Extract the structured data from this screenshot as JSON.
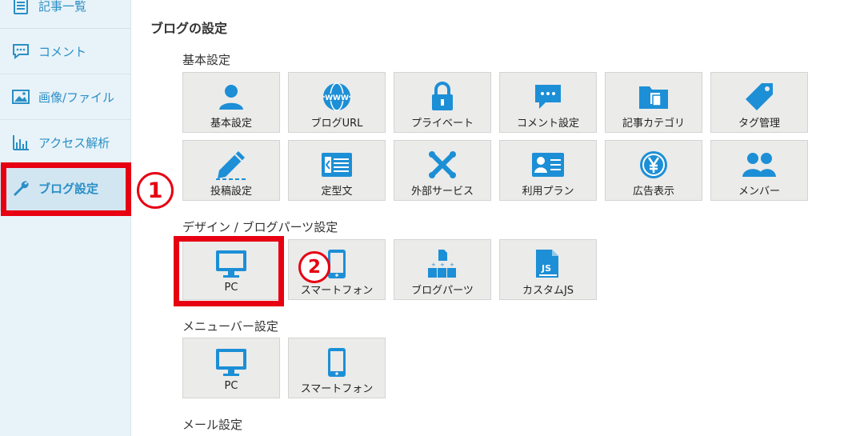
{
  "sidebar": {
    "items": [
      {
        "label": "記事一覧",
        "icon": "document-list-icon",
        "active": false
      },
      {
        "label": "コメント",
        "icon": "comment-icon",
        "active": false
      },
      {
        "label": "画像/ファイル",
        "icon": "image-icon",
        "active": false
      },
      {
        "label": "アクセス解析",
        "icon": "bar-chart-icon",
        "active": false
      },
      {
        "label": "ブログ設定",
        "icon": "wrench-icon",
        "active": true
      }
    ]
  },
  "main": {
    "title": "ブログの設定",
    "sections": [
      {
        "title": "基本設定",
        "tiles": [
          {
            "label": "基本設定",
            "icon": "user-icon"
          },
          {
            "label": "ブログURL",
            "icon": "www-globe-icon"
          },
          {
            "label": "プライベート",
            "icon": "lock-icon"
          },
          {
            "label": "コメント設定",
            "icon": "speech-bubble-icon"
          },
          {
            "label": "記事カテゴリ",
            "icon": "folder-icon"
          },
          {
            "label": "タグ管理",
            "icon": "tag-icon"
          },
          {
            "label": "投稿設定",
            "icon": "pencil-icon"
          },
          {
            "label": "定型文",
            "icon": "template-icon"
          },
          {
            "label": "外部サービス",
            "icon": "external-service-icon"
          },
          {
            "label": "利用プラン",
            "icon": "id-card-icon"
          },
          {
            "label": "広告表示",
            "icon": "yen-coin-icon"
          },
          {
            "label": "メンバー",
            "icon": "members-icon"
          }
        ]
      },
      {
        "title": "デザイン / ブログパーツ設定",
        "tiles": [
          {
            "label": "PC",
            "icon": "monitor-icon"
          },
          {
            "label": "スマートフォン",
            "icon": "smartphone-icon"
          },
          {
            "label": "ブログパーツ",
            "icon": "blog-parts-icon"
          },
          {
            "label": "カスタムJS",
            "icon": "js-file-icon"
          }
        ]
      },
      {
        "title": "メニューバー設定",
        "tiles": [
          {
            "label": "PC",
            "icon": "monitor-icon"
          },
          {
            "label": "スマートフォン",
            "icon": "smartphone-icon"
          }
        ]
      },
      {
        "title": "メール設定",
        "tiles": []
      }
    ]
  },
  "annotations": {
    "marker_1": "1",
    "marker_2": "2"
  },
  "colors": {
    "accent": "#2a8fc6",
    "icon_blue": "#1c8fd6",
    "annotation_red": "#e60012",
    "tile_bg": "#ebebea",
    "sidebar_bg": "#e8f3f9"
  }
}
